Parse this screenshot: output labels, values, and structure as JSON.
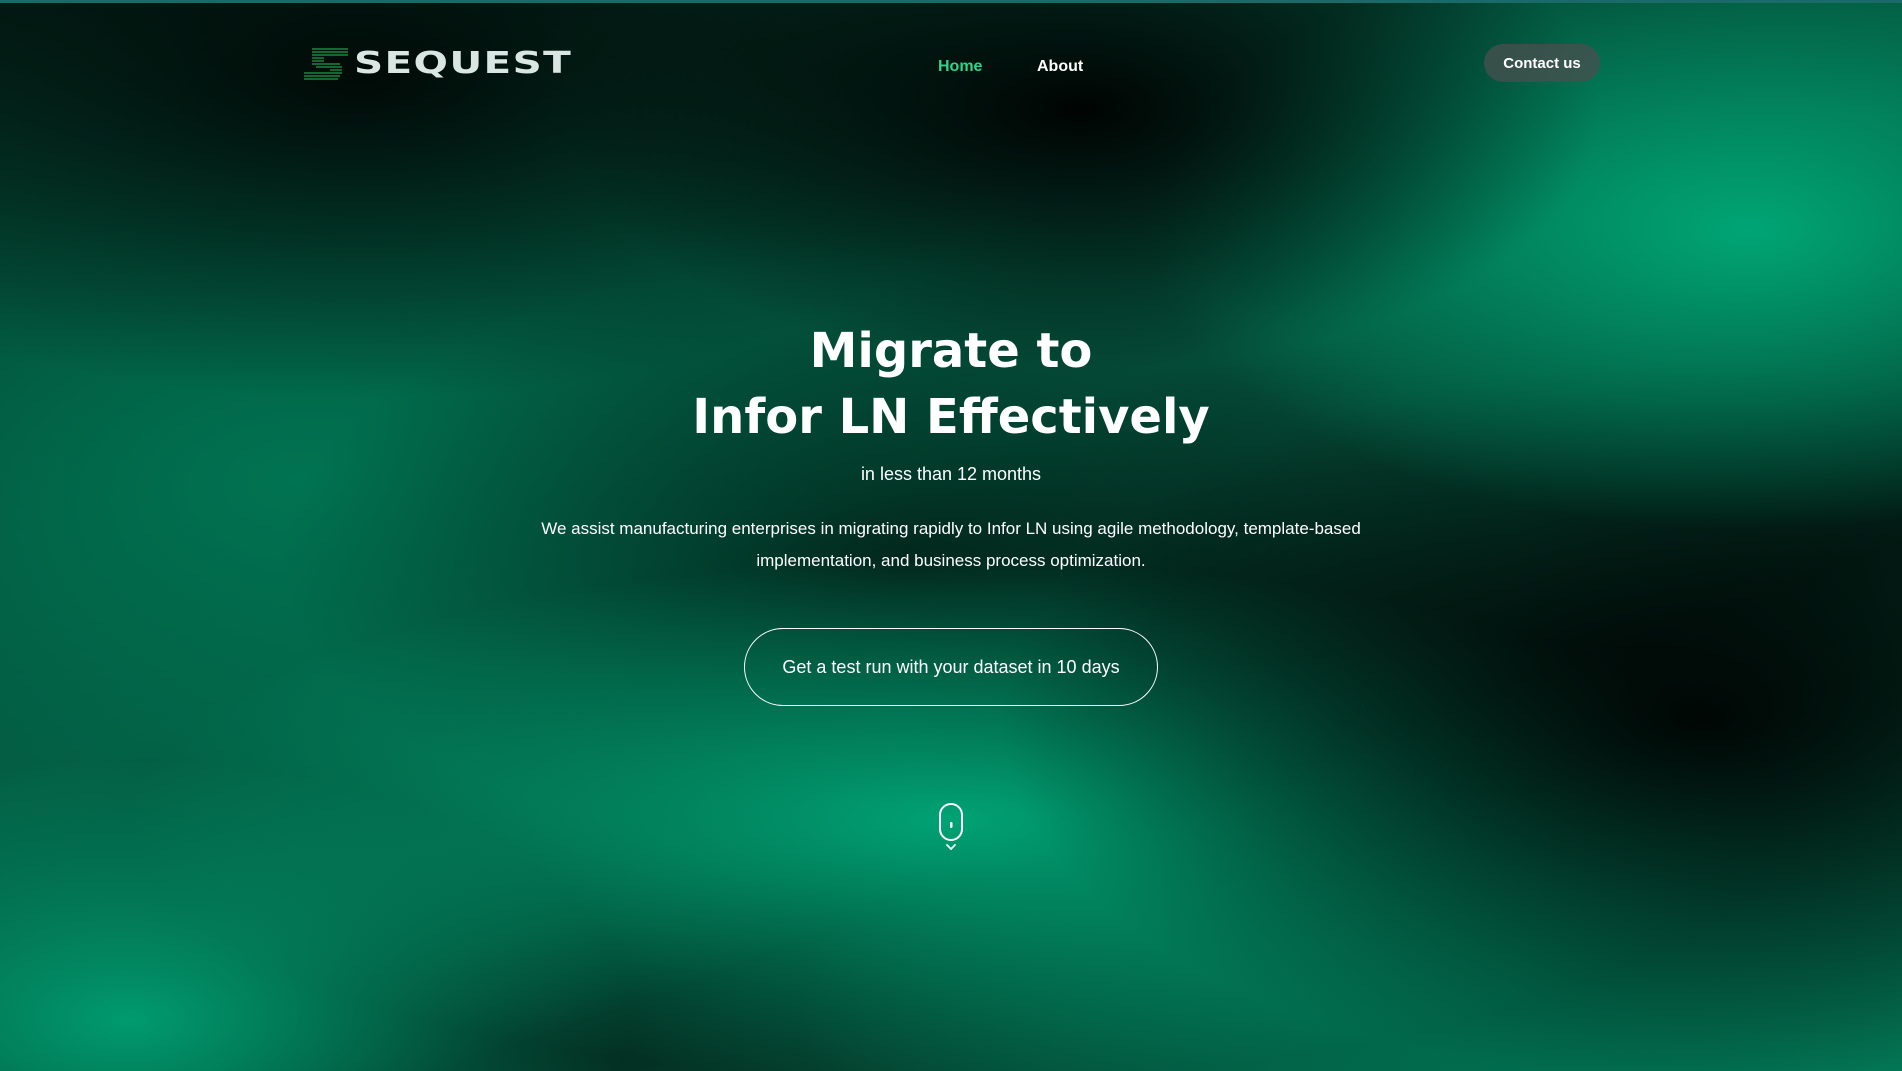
{
  "brand": {
    "name": "SEQUEST",
    "logo_icon": "sequest-s-logo-icon",
    "accent_color": "#2fd38c"
  },
  "nav": {
    "items": [
      {
        "label": "Home",
        "active": true
      },
      {
        "label": "About",
        "active": false
      }
    ]
  },
  "header": {
    "contact_label": "Contact us"
  },
  "hero": {
    "title_line1": "Migrate to",
    "title_line2": "Infor LN Effectively",
    "subtitle": "in less than 12 months",
    "description": "We assist manufacturing enterprises in migrating rapidly to Infor LN using agile methodology, template-based implementation, and business process optimization.",
    "cta_label": "Get a test run with your dataset in 10 days"
  },
  "scroll": {
    "icon": "mouse-scroll-icon"
  }
}
